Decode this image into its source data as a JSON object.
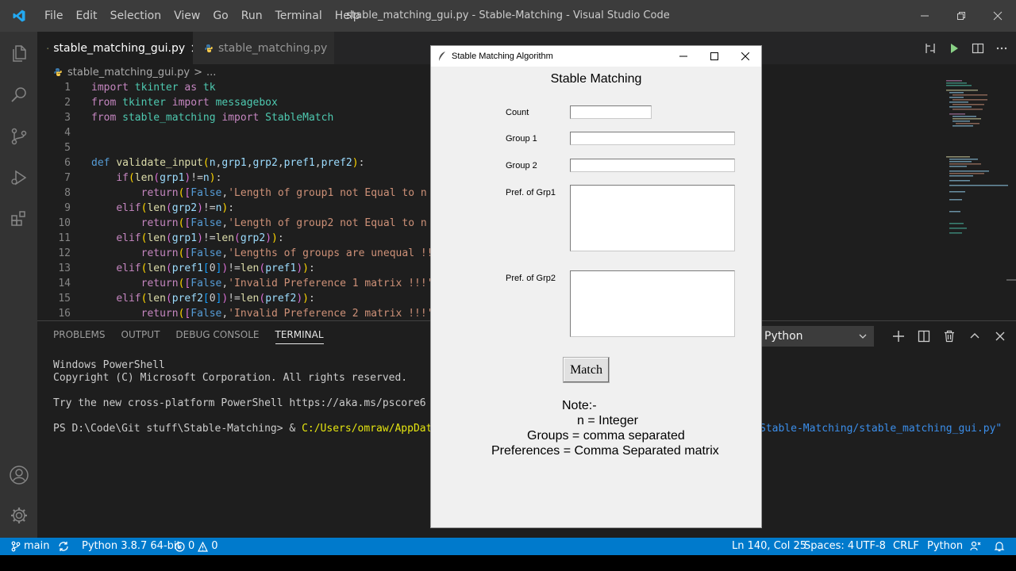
{
  "titlebar": {
    "menu": [
      "File",
      "Edit",
      "Selection",
      "View",
      "Go",
      "Run",
      "Terminal",
      "Help"
    ],
    "window_title": "stable_matching_gui.py - Stable-Matching - Visual Studio Code"
  },
  "tabs": [
    {
      "label": "stable_matching_gui.py",
      "active": true
    },
    {
      "label": "stable_matching.py",
      "active": false
    }
  ],
  "breadcrumb": {
    "file": "stable_matching_gui.py",
    "separator": ">",
    "rest": "..."
  },
  "editor": {
    "line_numbers": [
      "1",
      "2",
      "3",
      "4",
      "5",
      "6",
      "7",
      "8",
      "9",
      "10",
      "11",
      "12",
      "13",
      "14",
      "15",
      "16"
    ]
  },
  "panel": {
    "tabs": [
      "PROBLEMS",
      "OUTPUT",
      "DEBUG CONSOLE",
      "TERMINAL"
    ],
    "active_tab": "TERMINAL",
    "terminal_select": "Python",
    "terminal": {
      "line1": "Windows PowerShell",
      "line2": "Copyright (C) Microsoft Corporation. All rights reserved.",
      "line3": "Try the new cross-platform PowerShell https://aka.ms/pscore6",
      "prompt": "PS D:\\Code\\Git stuff\\Stable-Matching> & ",
      "command_start": "C:/Users/omraw/AppData/Lo",
      "command_end": "Stable-Matching/stable_matching_gui.py\""
    }
  },
  "statusbar": {
    "branch": "main",
    "python": "Python 3.8.7 64-bit",
    "errors": "0",
    "warnings": "0",
    "position": "Ln 140, Col 25",
    "spaces": "Spaces: 4",
    "encoding": "UTF-8",
    "eol": "CRLF",
    "language": "Python"
  },
  "tkwindow": {
    "title": "Stable Matching Algorithm",
    "heading": "Stable Matching",
    "labels": {
      "count": "Count",
      "group1": "Group 1",
      "group2": "Group 2",
      "pref1": "Pref. of Grp1",
      "pref2": "Pref. of Grp2"
    },
    "values": {
      "count": "",
      "group1": "",
      "group2": "",
      "pref1": "",
      "pref2": ""
    },
    "button": "Match",
    "note": {
      "line1": "Note:-",
      "line2": "n = Integer",
      "line3": "Groups = comma separated",
      "line4": "Preferences = Comma Separated matrix"
    }
  }
}
